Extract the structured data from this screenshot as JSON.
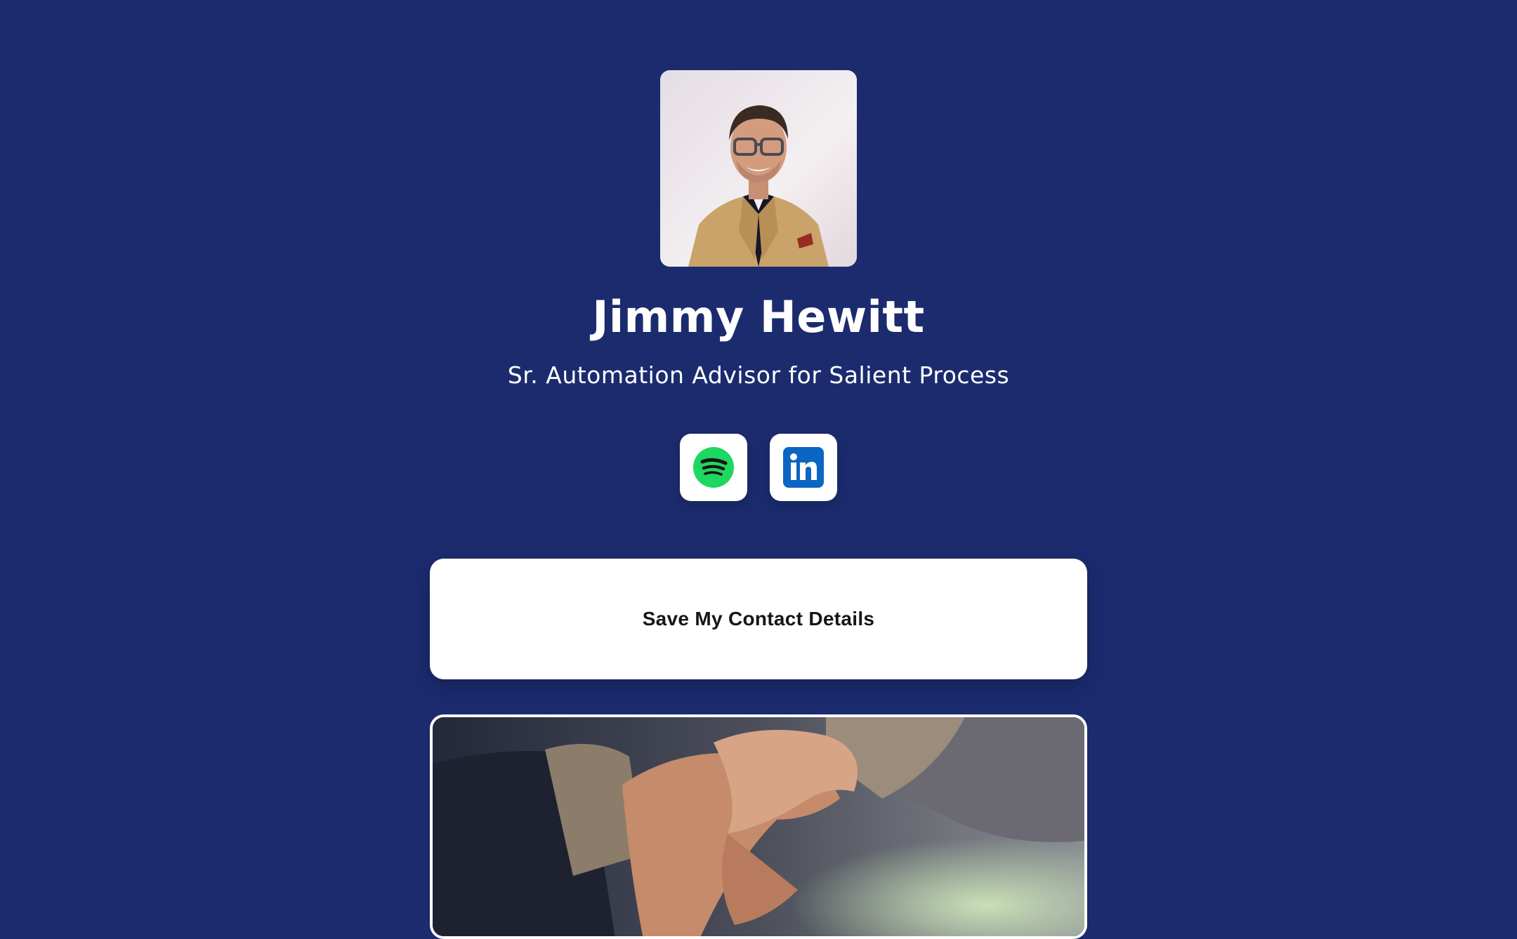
{
  "profile": {
    "name": "Jimmy Hewitt",
    "title": "Sr. Automation Advisor for Salient Process",
    "photo_icon": "profile-photo"
  },
  "socials": [
    {
      "icon": "spotify-icon",
      "color": "#1ed760"
    },
    {
      "icon": "linkedin-icon",
      "color": "#0a66c2"
    }
  ],
  "actions": {
    "save_contact_label": "Save My Contact Details"
  },
  "media": {
    "image_icon": "handshake-photo"
  },
  "colors": {
    "background": "#1b2b6e",
    "card": "#ffffff",
    "text_on_background": "#ffffff",
    "button_text": "#161616"
  }
}
